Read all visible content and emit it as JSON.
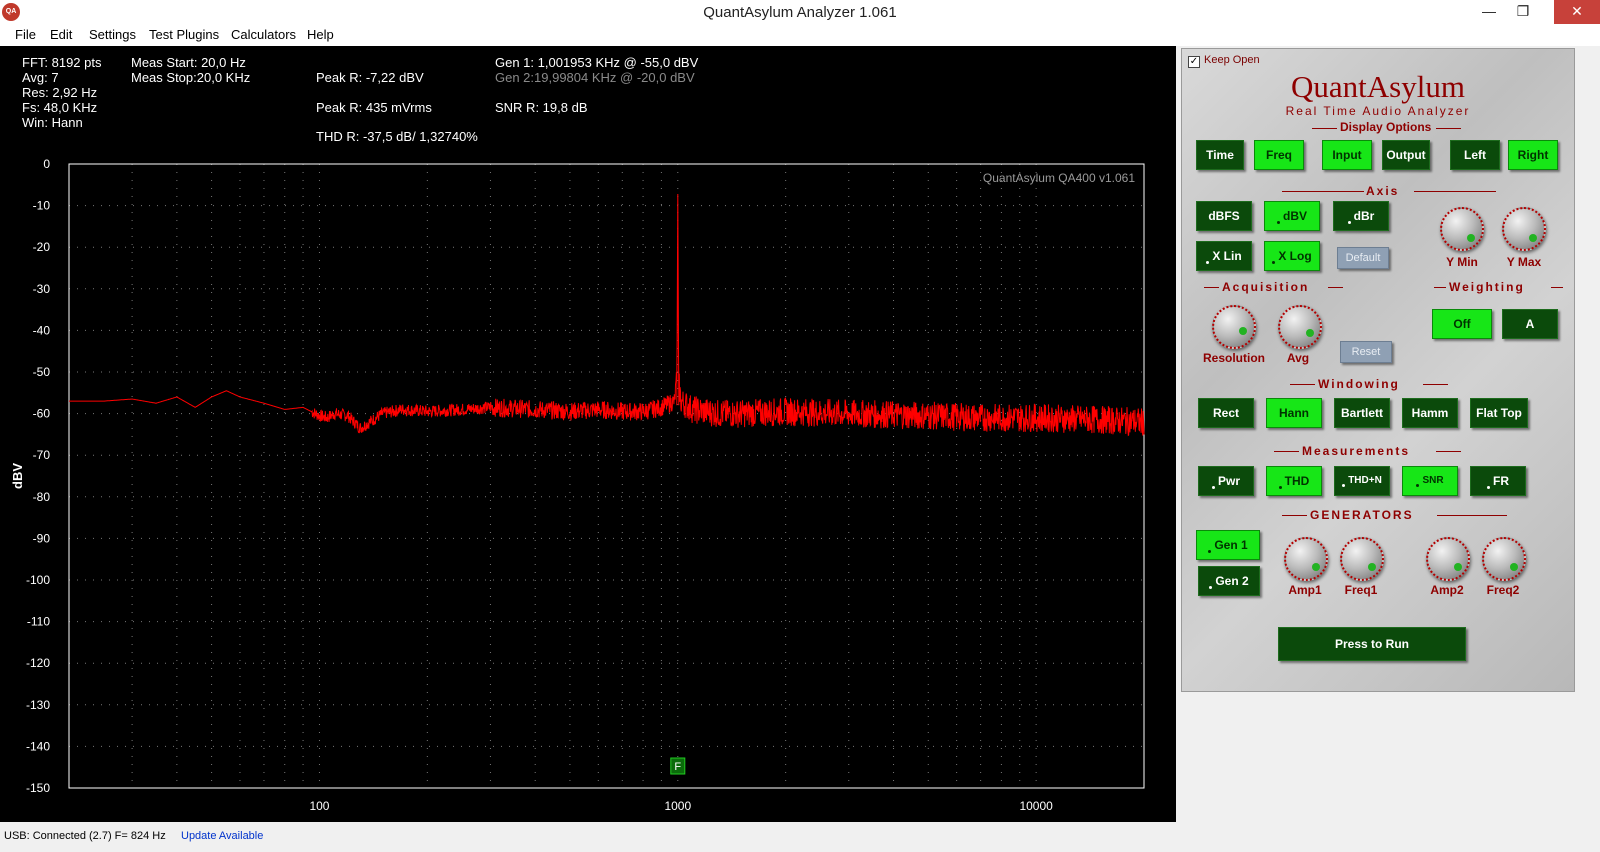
{
  "window": {
    "title": "QuantAsylum Analyzer 1.061",
    "icon_text": "QA"
  },
  "menu": [
    "File",
    "Edit",
    "Settings",
    "Test Plugins",
    "Calculators",
    "Help"
  ],
  "info": {
    "fft": "FFT: 8192 pts",
    "avg": "Avg: 7",
    "res": "Res: 2,92 Hz",
    "fs": "Fs: 48,0 KHz",
    "win": "Win: Hann",
    "meas_start": "Meas Start: 20,0 Hz",
    "meas_stop": "Meas Stop:20,0 KHz",
    "peak_r_dbv": "Peak R: -7,22 dBV",
    "peak_r_mvrms": "Peak R: 435 mVrms",
    "thd_r": "THD R: -37,5 dB/ 1,32740%",
    "gen1": "Gen 1: 1,001953 KHz @ -55,0  dBV",
    "gen2": "Gen 2:19,99804 KHz @ -20,0  dBV",
    "snr_r": "SNR R: 19,8 dB"
  },
  "chart_data": {
    "type": "line",
    "watermark": "QuantAsylum QA400 v1.061",
    "ylabel": "dBV",
    "xlabel": "",
    "xscale": "log",
    "xlim": [
      20,
      20000
    ],
    "ylim": [
      -150,
      0
    ],
    "y_ticks": [
      "0",
      "-10",
      "-20",
      "-30",
      "-40",
      "-50",
      "-60",
      "-70",
      "-80",
      "-90",
      "-100",
      "-110",
      "-120",
      "-130",
      "-140",
      "-150"
    ],
    "x_ticks": [
      "100",
      "1000",
      "10000"
    ],
    "grid": true,
    "marker_label": "F",
    "marker_freq": 1000,
    "series": [
      {
        "color": "#ff0000",
        "x": [
          20,
          25,
          30,
          35,
          40,
          45,
          50,
          55,
          60,
          70,
          80,
          90,
          100,
          105,
          110,
          120,
          130,
          150,
          170,
          200,
          250,
          300,
          400,
          500,
          600,
          700,
          800,
          900,
          980,
          995,
          1000,
          1005,
          1020,
          1100,
          1300,
          1500,
          2000,
          3000,
          5000,
          7000,
          10000,
          15000,
          20000
        ],
        "y": [
          -57,
          -57,
          -56.5,
          -57.5,
          -56,
          -58.5,
          -56,
          -54.5,
          -56,
          -57.5,
          -59,
          -58.5,
          -60.5,
          -61,
          -60,
          -60.5,
          -63.5,
          -60,
          -59,
          -59.5,
          -59,
          -58.5,
          -59,
          -59.5,
          -59,
          -59.5,
          -59.5,
          -58.5,
          -57,
          -50,
          -7.22,
          -52,
          -57,
          -59,
          -60,
          -60,
          -59.5,
          -60,
          -60.5,
          -61,
          -61,
          -61.5,
          -62
        ]
      }
    ]
  },
  "panel": {
    "keep_open": "Keep Open",
    "brand": "QuantAsylum",
    "subbrand": "Real Time Audio Analyzer",
    "sections": {
      "display": "Display Options",
      "axis": "Axis",
      "acquisition": "Acquisition",
      "weighting": "Weighting",
      "windowing": "Windowing",
      "measurements": "Measurements",
      "generators": "GENERATORS"
    },
    "display_buttons": {
      "time": "Time",
      "freq": "Freq",
      "input": "Input",
      "output": "Output",
      "left": "Left",
      "right": "Right"
    },
    "axis_buttons": {
      "dbfs": "dBFS",
      "dbv": "dBV",
      "dbr": "dBr",
      "xlin": "X Lin",
      "xlog": "X Log",
      "default": "Default"
    },
    "axis_knobs": {
      "ymin": "Y Min",
      "ymax": "Y Max"
    },
    "acq_knobs": {
      "resolution": "Resolution",
      "avg": "Avg"
    },
    "reset": "Reset",
    "weighting_buttons": {
      "off": "Off",
      "a": "A"
    },
    "window_buttons": {
      "rect": "Rect",
      "hann": "Hann",
      "bartlett": "Bartlett",
      "hamm": "Hamm",
      "flattop": "Flat Top"
    },
    "meas_buttons": {
      "pwr": "Pwr",
      "thd": "THD",
      "thdn": "THD+N",
      "snr": "SNR",
      "fr": "FR"
    },
    "gen_buttons": {
      "gen1": "Gen 1",
      "gen2": "Gen 2"
    },
    "gen_knobs": {
      "amp1": "Amp1",
      "freq1": "Freq1",
      "amp2": "Amp2",
      "freq2": "Freq2"
    },
    "run": "Press to Run"
  },
  "status": {
    "usb": "USB: Connected  (2.7)  F= 824 Hz",
    "update": "Update Available"
  }
}
